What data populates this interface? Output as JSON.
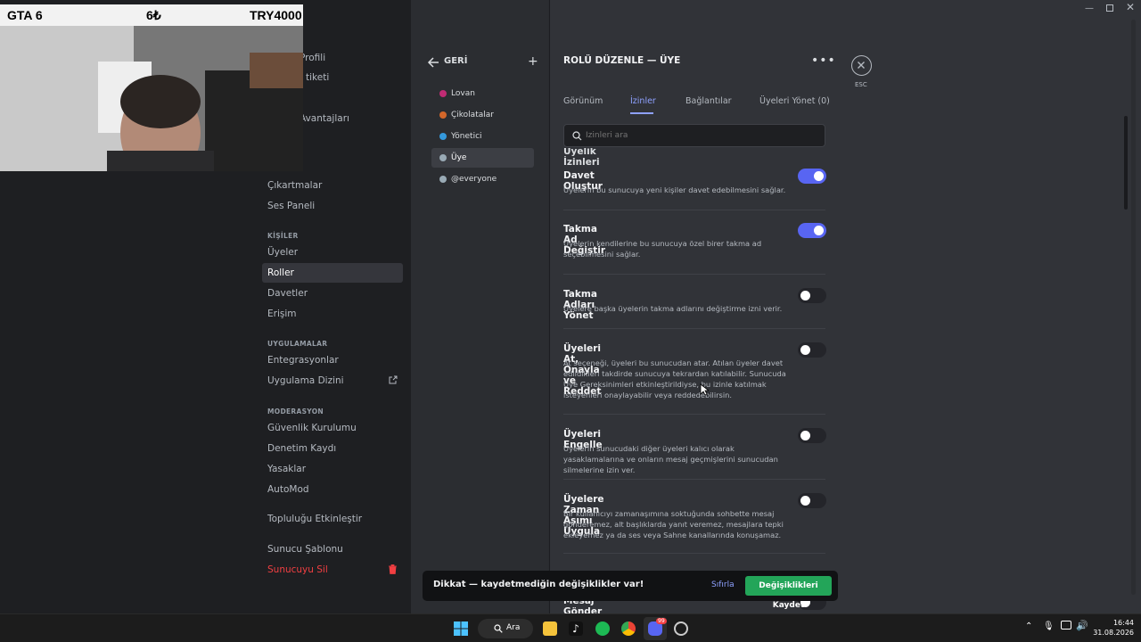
{
  "webcam": {
    "game": "GTA 6",
    "price": "6₺",
    "currency": "TRY4000"
  },
  "sidebar": {
    "partial_items": [
      "Profili",
      "tiketi",
      "Avantajları"
    ],
    "items_top": [
      "Çıkartmalar",
      "Ses Paneli"
    ],
    "section_people": "KİŞİLER",
    "people": [
      "Üyeler",
      "Roller",
      "Davetler",
      "Erişim"
    ],
    "section_apps": "UYGULAMALAR",
    "apps": [
      "Entegrasyonlar",
      "Uygulama Dizini"
    ],
    "section_mod": "MODERASYON",
    "mod": [
      "Güvenlik Kurulumu",
      "Denetim Kaydı",
      "Yasaklar",
      "AutoMod"
    ],
    "community": "Topluluğu Etkinleştir",
    "template": "Sunucu Şablonu",
    "delete": "Sunucuyu Sil"
  },
  "roles": {
    "back": "GERİ",
    "list": [
      {
        "name": "Lovan",
        "color": "#c02b74"
      },
      {
        "name": "Çikolatalar",
        "color": "#d3672a"
      },
      {
        "name": "Yönetici",
        "color": "#3498db"
      },
      {
        "name": "Üye",
        "color": "#99aab5"
      },
      {
        "name": "@everyone",
        "color": "#99aab5"
      }
    ]
  },
  "main": {
    "title": "ROLÜ DÜZENLE — ÜYE",
    "esc": "ESC",
    "tabs": [
      "Görünüm",
      "İzinler",
      "Bağlantılar",
      "Üyeleri Yönet (0)"
    ],
    "search_placeholder": "İzinleri ara",
    "section_partial": "Üyelik İzinleri",
    "permissions": [
      {
        "title": "Davet Oluştur",
        "desc": "Üyelerin bu sunucuya yeni kişiler davet edebilmesini sağlar.",
        "enabled": true
      },
      {
        "title": "Takma Ad Değiştir",
        "desc": "Üyelerin kendilerine bu sunucuya özel birer takma ad seçebilmesini sağlar.",
        "enabled": true
      },
      {
        "title": "Takma Adları Yönet",
        "desc": "Üyelere başka üyelerin takma adlarını değiştirme izni verir.",
        "enabled": false
      },
      {
        "title": "Üyeleri At, Onayla ve Reddet",
        "desc": "At seçeneği, üyeleri bu sunucudan atar. Atılan üyeler davet edildikleri takdirde sunucuya tekrardan katılabilir. Sunucuda Üye Gereksinimleri etkinleştirildiyse, bu izinle katılmak isteyenleri onaylayabilir veya reddedebilirsin.",
        "enabled": false
      },
      {
        "title": "Üyeleri Engelle",
        "desc": "Üyelerin sunucudaki diğer üyeleri kalıcı olarak yasaklamalarına ve onların mesaj geçmişlerini sunucudan silmelerine izin ver.",
        "enabled": false
      },
      {
        "title": "Üyelere Zaman Aşımı Uygula",
        "desc": "Bir kullanıcıyı zamanaşımına soktuğunda sohbette mesaj gönderemez, alt başlıklarda yanıt veremez, mesajlara tepki ekleyemez ya da ses veya Sahne kanallarında konuşamaz.",
        "enabled": false
      }
    ],
    "partial_next": "Mesaj Gönder ve Gönderi Oluştur"
  },
  "savebar": {
    "warning": "Dikkat — kaydetmediğin değişiklikler var!",
    "reset": "Sıfırla",
    "save": "Değişiklikleri Kaydet"
  },
  "taskbar": {
    "search": "Ara",
    "time": "16:44",
    "date": "31.08.2026",
    "badge": "99"
  }
}
